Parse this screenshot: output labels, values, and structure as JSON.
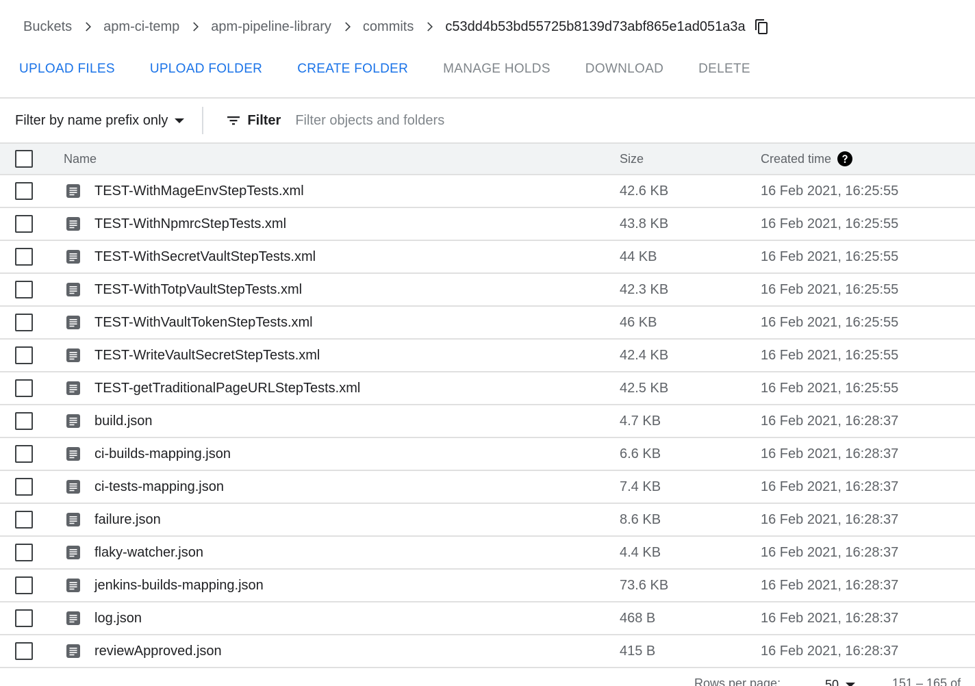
{
  "breadcrumb": {
    "items": [
      "Buckets",
      "apm-ci-temp",
      "apm-pipeline-library",
      "commits"
    ],
    "current": "c53dd4b53bd55725b8139d73abf865e1ad051a3a"
  },
  "actions": [
    {
      "label": "UPLOAD FILES",
      "enabled": true
    },
    {
      "label": "UPLOAD FOLDER",
      "enabled": true
    },
    {
      "label": "CREATE FOLDER",
      "enabled": true
    },
    {
      "label": "MANAGE HOLDS",
      "enabled": false
    },
    {
      "label": "DOWNLOAD",
      "enabled": false
    },
    {
      "label": "DELETE",
      "enabled": false
    }
  ],
  "filter": {
    "mode_label": "Filter by name prefix only",
    "filter_label": "Filter",
    "placeholder": "Filter objects and folders"
  },
  "table": {
    "columns": {
      "name": "Name",
      "size": "Size",
      "created": "Created time"
    },
    "rows": [
      {
        "name": "TEST-WithMageEnvStepTests.xml",
        "size": "42.6 KB",
        "created": "16 Feb 2021, 16:25:55"
      },
      {
        "name": "TEST-WithNpmrcStepTests.xml",
        "size": "43.8 KB",
        "created": "16 Feb 2021, 16:25:55"
      },
      {
        "name": "TEST-WithSecretVaultStepTests.xml",
        "size": "44 KB",
        "created": "16 Feb 2021, 16:25:55"
      },
      {
        "name": "TEST-WithTotpVaultStepTests.xml",
        "size": "42.3 KB",
        "created": "16 Feb 2021, 16:25:55"
      },
      {
        "name": "TEST-WithVaultTokenStepTests.xml",
        "size": "46 KB",
        "created": "16 Feb 2021, 16:25:55"
      },
      {
        "name": "TEST-WriteVaultSecretStepTests.xml",
        "size": "42.4 KB",
        "created": "16 Feb 2021, 16:25:55"
      },
      {
        "name": "TEST-getTraditionalPageURLStepTests.xml",
        "size": "42.5 KB",
        "created": "16 Feb 2021, 16:25:55"
      },
      {
        "name": "build.json",
        "size": "4.7 KB",
        "created": "16 Feb 2021, 16:28:37"
      },
      {
        "name": "ci-builds-mapping.json",
        "size": "6.6 KB",
        "created": "16 Feb 2021, 16:28:37"
      },
      {
        "name": "ci-tests-mapping.json",
        "size": "7.4 KB",
        "created": "16 Feb 2021, 16:28:37"
      },
      {
        "name": "failure.json",
        "size": "8.6 KB",
        "created": "16 Feb 2021, 16:28:37"
      },
      {
        "name": "flaky-watcher.json",
        "size": "4.4 KB",
        "created": "16 Feb 2021, 16:28:37"
      },
      {
        "name": "jenkins-builds-mapping.json",
        "size": "73.6 KB",
        "created": "16 Feb 2021, 16:28:37"
      },
      {
        "name": "log.json",
        "size": "468 B",
        "created": "16 Feb 2021, 16:28:37"
      },
      {
        "name": "reviewApproved.json",
        "size": "415 B",
        "created": "16 Feb 2021, 16:28:37"
      }
    ]
  },
  "pagination": {
    "rows_per_page_label": "Rows per page:",
    "rows_per_page_value": "50",
    "range_label": "151 – 165 of"
  },
  "colors": {
    "accent": "#1a73e8",
    "disabled": "#80868b",
    "header_bg": "#f1f3f4"
  }
}
